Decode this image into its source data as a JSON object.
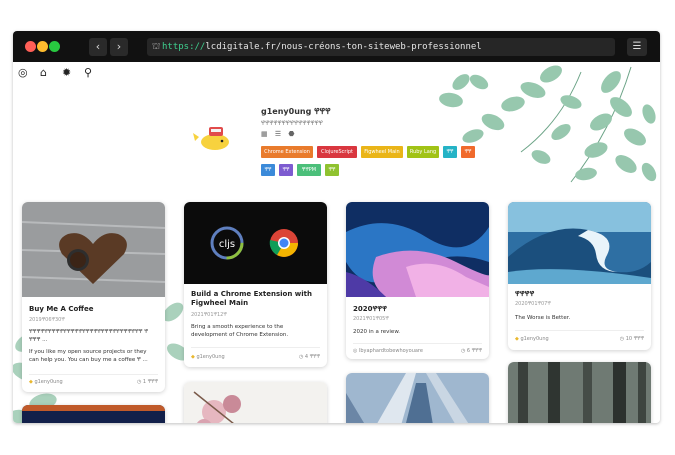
{
  "browser": {
    "url_protocol": "https://",
    "url_rest": "lcdigitale.fr/nous-créons-ton-siteweb-professionnel",
    "back_glyph": "‹",
    "forward_glyph": "›",
    "menu_glyph": "☰",
    "lock_glyph": "🔒"
  },
  "nav_icons": [
    {
      "name": "github-icon",
      "glyph": "◎"
    },
    {
      "name": "home-icon",
      "glyph": "⌂"
    },
    {
      "name": "settings-icon",
      "glyph": "✹"
    },
    {
      "name": "search-icon",
      "glyph": "⚲"
    }
  ],
  "profile": {
    "username": "g1eny0ung 𐐐𐐐𐐐",
    "bio": "𐐐𐐐𐐐𐐐𐐐𐐐𐐐𐐐𐐐𐐐𐐐𐐐𐐐𐐐𐐐",
    "mini_icons": [
      "▦",
      "☰",
      "⬣"
    ]
  },
  "tags": [
    {
      "label": "Chrome Extension",
      "color": "#e97b2c"
    },
    {
      "label": "ClojureScript",
      "color": "#d9373f"
    },
    {
      "label": "Figwheel Main",
      "color": "#eab518"
    },
    {
      "label": "Ruby Lang",
      "color": "#a1c316"
    },
    {
      "label": "𐐐𐐐",
      "color": "#25b3c6"
    },
    {
      "label": "𐐐𐐐",
      "color": "#f06a2c"
    },
    {
      "label": "𐐐𐐐",
      "color": "#3b8ad9"
    },
    {
      "label": "𐐐𐐐",
      "color": "#7d5bd0"
    },
    {
      "label": "𐐐𐐐PM",
      "color": "#4bbf7a"
    },
    {
      "label": "𐐐𐐐",
      "color": "#8fc22f"
    }
  ],
  "cards": [
    {
      "title": "Buy Me A Coffee",
      "date": "2019𐐐06𐐐30𐐐",
      "excerpt": "𐐐𐐐𐐐𐐐𐐐𐐐𐐐𐐐𐐐𐐐𐐐𐐐𐐐𐐐𐐐𐐐𐐐𐐐𐐐𐐐𐐐𐐐𐐐𐐐𐐐𐐐𐐐𐐐𐐐𐐐 𐐐 𐐐𐐐𐐐 ...",
      "excerpt2": "If you like my open source projects or they can help you. You can buy me a coffee 𐐐 ...",
      "author": "g1eny0ung",
      "read_time": "1 𐐐𐐐𐐐"
    },
    {
      "title": "Build a Chrome Extension with Figwheel Main",
      "date": "2021𐐐01𐐐12𐐐",
      "excerpt": "Bring a smooth experience to the development of Chrome Extension.",
      "author": "g1eny0ung",
      "read_time": "4 𐐐𐐐𐐐",
      "logo_text": "cljs"
    },
    {
      "title": "2020𐐐𐐐𐐐",
      "date": "2021𐐐01𐐐05𐐐",
      "excerpt": "2020 in a review.",
      "author": "lbyaphardtobewhoyouare",
      "read_time": "6 𐐐𐐐𐐐"
    },
    {
      "title": "𐐐𐐐𐐐𐐐",
      "date": "2020𐐐01𐐐07𐐐",
      "excerpt": "The Worse is Better.",
      "author": "g1eny0ung",
      "read_time": "10 𐐐𐐐𐐐"
    }
  ],
  "colors": {
    "titlebar": "#111111",
    "dot_red": "#ff5f57",
    "dot_yellow": "#febc2e",
    "dot_green": "#28c840",
    "leaf": "#7fb89a"
  }
}
